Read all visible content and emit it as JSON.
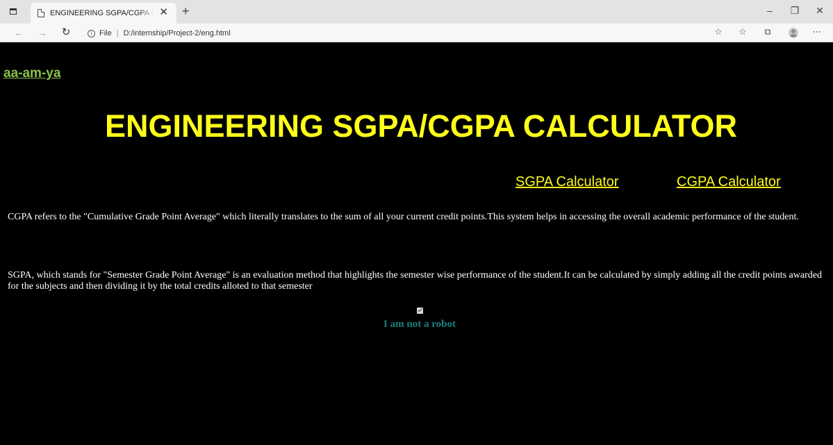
{
  "browser": {
    "tab_title": "ENGINEERING SGPA/CGPA CALC",
    "address_prefix": "File",
    "address_path": "D:/internship/Project-2/eng.html"
  },
  "icons": {
    "tab_actions": "tab-actions-icon",
    "page": "page-icon",
    "close": "close-icon",
    "new_tab": "plus-icon",
    "minimize": "minimize-icon",
    "restore": "restore-icon",
    "window_close": "close-icon",
    "back": "back-arrow-icon",
    "forward": "forward-arrow-icon",
    "refresh": "refresh-icon",
    "info": "info-icon",
    "read_aloud": "read-aloud-icon",
    "favorites": "favorites-icon",
    "collections": "collections-icon",
    "profile": "profile-avatar",
    "more": "more-icon"
  },
  "page": {
    "brand": "aa-am-ya",
    "title": "ENGINEERING SGPA/CGPA CALCULATOR",
    "nav": {
      "sgpa": "SGPA Calculator",
      "cgpa": "CGPA Calculator"
    },
    "cgpa_text": "CGPA refers to the \"Cumulative Grade Point Average\" which literally translates to the sum of all your current credit points.This system helps in accessing the overall academic performance of the student.",
    "sgpa_text": "SGPA, which stands for \"Semester Grade Point Average\" is an evaluation method that highlights the semester wise performance of the student.It can be calculated by simply adding all the credit points awarded for the subjects and then dividing it by the total credits alloted to that semester",
    "robot_label": "I am not a robot",
    "robot_checked": true
  },
  "colors": {
    "background": "#000000",
    "title": "#ffff1a",
    "brand": "#8bc34a",
    "robot_label": "#1a8080",
    "body_text": "#ffffff"
  }
}
